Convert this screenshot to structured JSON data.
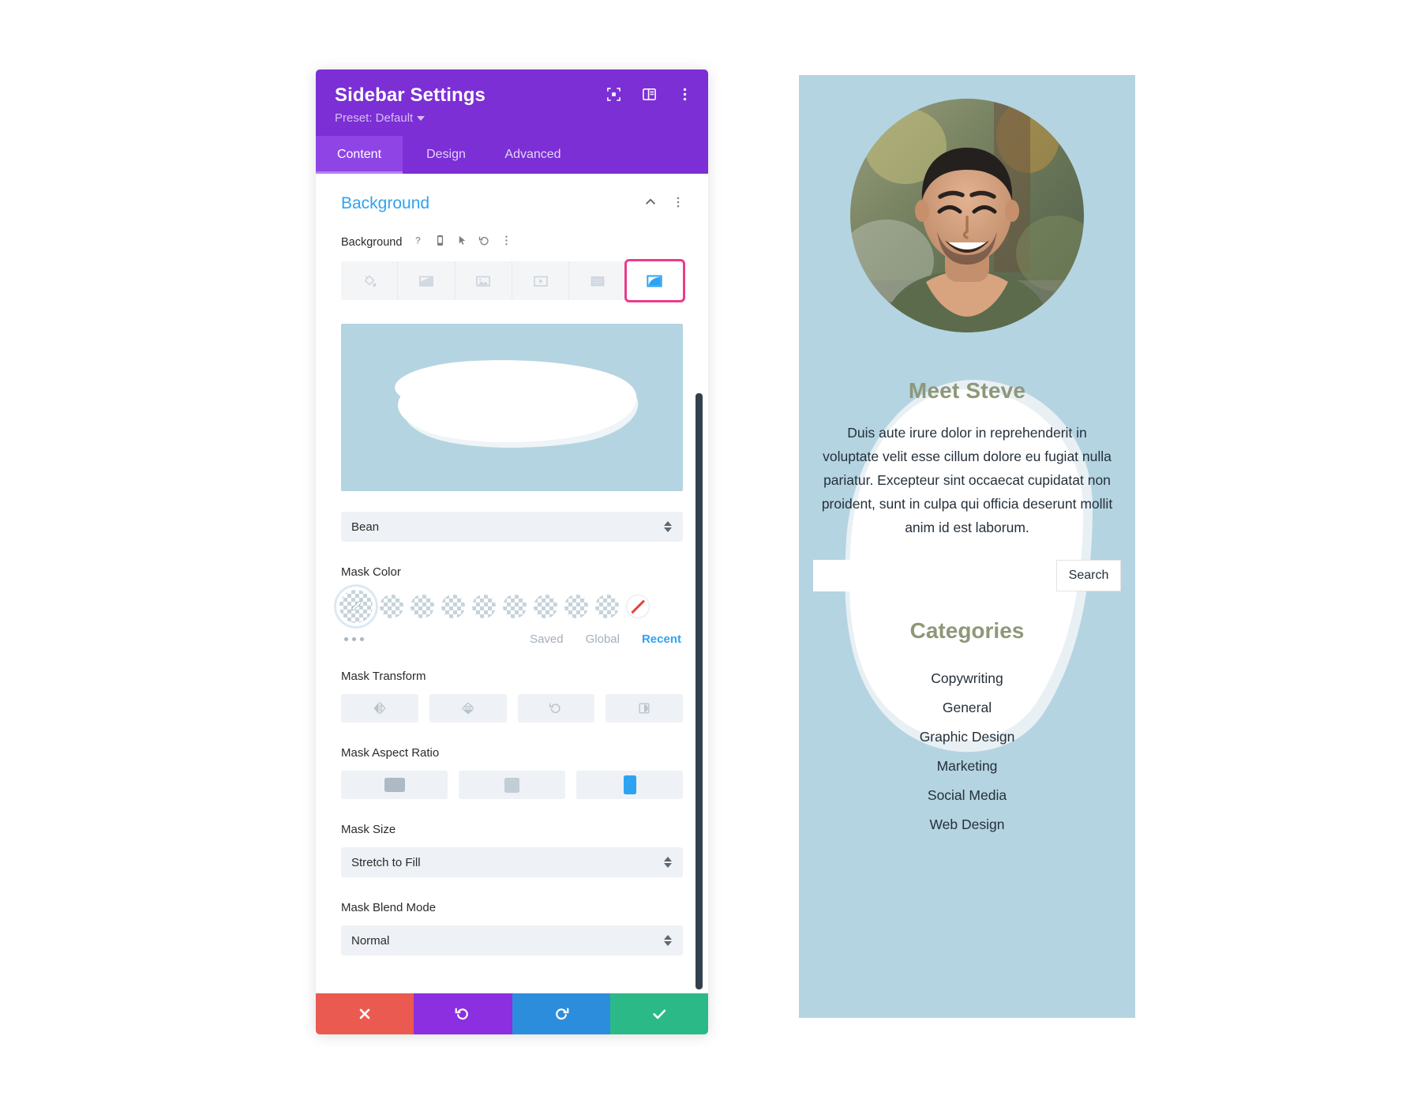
{
  "settings_panel": {
    "title": "Sidebar Settings",
    "preset_label": "Preset: Default",
    "header_icons": [
      "focus-icon",
      "layout-panel-icon",
      "kebab-menu-icon"
    ],
    "tabs": [
      {
        "label": "Content",
        "active": true
      },
      {
        "label": "Design",
        "active": false
      },
      {
        "label": "Advanced",
        "active": false
      }
    ],
    "section": {
      "title": "Background",
      "collapse_icon": "chevron-up-icon",
      "options_icon": "kebab-menu-icon"
    },
    "background_field": {
      "label": "Background",
      "row_icons": [
        "help-icon",
        "responsive-phone-icon",
        "hover-cursor-icon",
        "reset-icon",
        "kebab-menu-icon"
      ],
      "types": [
        {
          "name": "color-fill",
          "selected": false
        },
        {
          "name": "gradient",
          "selected": false
        },
        {
          "name": "image",
          "selected": false
        },
        {
          "name": "video",
          "selected": false
        },
        {
          "name": "pattern",
          "selected": false
        },
        {
          "name": "mask",
          "selected": true
        }
      ],
      "highlight_color": "#ec3b8b"
    },
    "mask_preview": {
      "shape": "bean",
      "background_color": "#b4d4e1",
      "shape_color": "#ffffff"
    },
    "mask_style": {
      "label": "",
      "value": "Bean"
    },
    "mask_color": {
      "label": "Mask Color",
      "swatches": [
        "eyedropper",
        "transparent",
        "transparent",
        "transparent",
        "transparent",
        "transparent",
        "transparent",
        "transparent",
        "transparent",
        "none"
      ],
      "more_icon": "more-dots-icon",
      "tabs": [
        {
          "label": "Saved",
          "active": false
        },
        {
          "label": "Global",
          "active": false
        },
        {
          "label": "Recent",
          "active": true
        }
      ],
      "active_tab_color": "#2ea3f2"
    },
    "mask_transform": {
      "label": "Mask Transform",
      "buttons": [
        "flip-horizontal-icon",
        "flip-vertical-icon",
        "rotate-icon",
        "invert-icon"
      ]
    },
    "mask_aspect_ratio": {
      "label": "Mask Aspect Ratio",
      "options": [
        {
          "name": "landscape",
          "selected": false
        },
        {
          "name": "square",
          "selected": false
        },
        {
          "name": "portrait",
          "selected": true
        }
      ],
      "selected_color": "#2ea3f2"
    },
    "mask_size": {
      "label": "Mask Size",
      "value": "Stretch to Fill"
    },
    "mask_blend_mode": {
      "label": "Mask Blend Mode",
      "value": "Normal"
    },
    "footer": [
      {
        "name": "cancel",
        "icon": "close-x-icon",
        "color": "#eb5a50"
      },
      {
        "name": "undo",
        "icon": "undo-icon",
        "color": "#8b2fe0"
      },
      {
        "name": "redo",
        "icon": "redo-icon",
        "color": "#2d8ddd"
      },
      {
        "name": "save",
        "icon": "checkmark-icon",
        "color": "#2bba87"
      }
    ]
  },
  "preview_sidebar": {
    "background_color": "#b4d4e1",
    "avatar_alt": "portrait-photo",
    "heading": "Meet Steve",
    "heading_color": "#8e9779",
    "body_text": "Duis aute irure dolor in reprehenderit in voluptate velit esse cillum dolore eu fugiat nulla pariatur. Excepteur sint occaecat cupidatat non proident, sunt in culpa qui officia deserunt mollit anim id est laborum.",
    "search": {
      "value": "",
      "placeholder": "",
      "button_label": "Search"
    },
    "categories_heading": "Categories",
    "categories": [
      "Copywriting",
      "General",
      "Graphic Design",
      "Marketing",
      "Social Media",
      "Web Design"
    ]
  }
}
